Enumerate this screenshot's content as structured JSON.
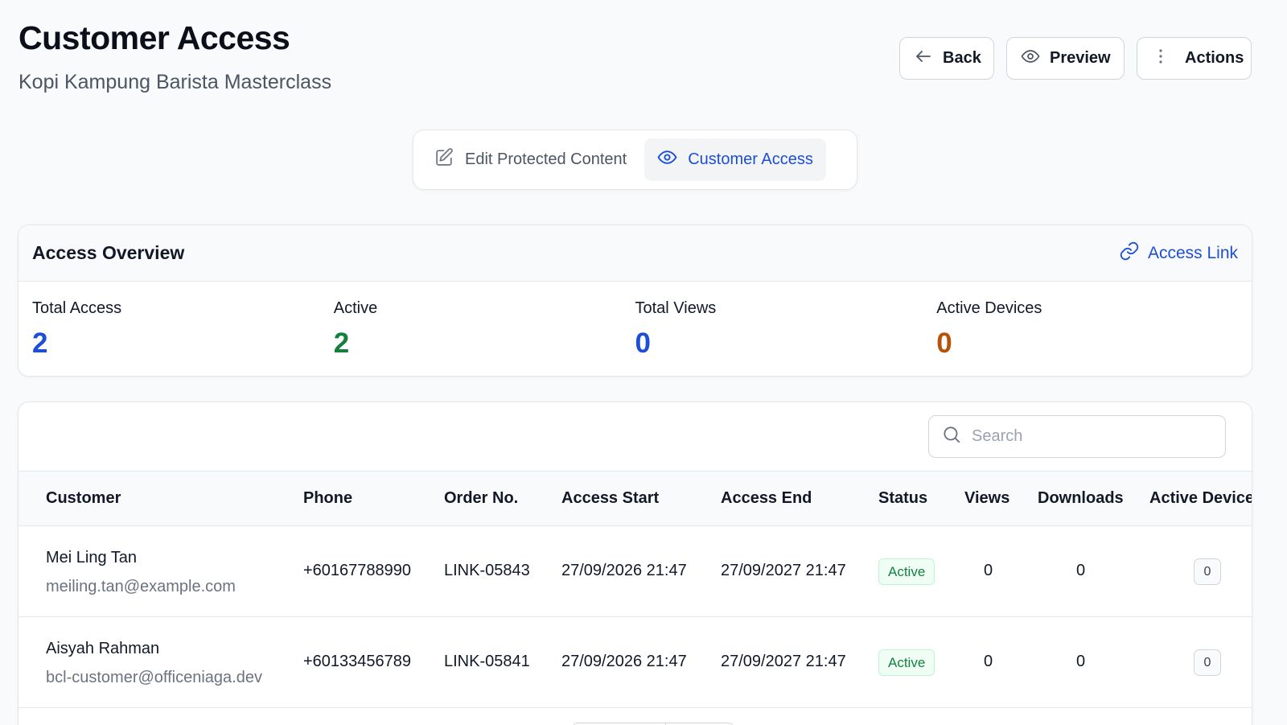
{
  "header": {
    "title": "Customer Access",
    "subtitle": "Kopi Kampung Barista Masterclass",
    "back_label": "Back",
    "preview_label": "Preview",
    "actions_label": "Actions"
  },
  "tabs": [
    {
      "label": "Edit Protected Content",
      "icon": "pencil-square-icon",
      "active": false
    },
    {
      "label": "Customer Access",
      "icon": "eye-icon",
      "active": true
    }
  ],
  "overview": {
    "title": "Access Overview",
    "access_link_label": "Access Link",
    "stats": [
      {
        "label": "Total Access",
        "value": "2",
        "color": "#1d4ed8"
      },
      {
        "label": "Active",
        "value": "2",
        "color": "#15803d"
      },
      {
        "label": "Total Views",
        "value": "0",
        "color": "#1d4ed8"
      },
      {
        "label": "Active Devices",
        "value": "0",
        "color": "#b45309"
      }
    ]
  },
  "search": {
    "placeholder": "Search",
    "value": ""
  },
  "table": {
    "columns": [
      "Customer",
      "Phone",
      "Order No.",
      "Access Start",
      "Access End",
      "Status",
      "Views",
      "Downloads",
      "Active Device"
    ],
    "rows": [
      {
        "name": "Mei Ling Tan",
        "email": "meiling.tan@example.com",
        "phone": "+60167788990",
        "order_no": "LINK-05843",
        "access_start": "27/09/2026 21:47",
        "access_end": "27/09/2027 21:47",
        "status": "Active",
        "views": "0",
        "downloads": "0",
        "active_devices": "0"
      },
      {
        "name": "Aisyah Rahman",
        "email": "bcl-customer@officeniaga.dev",
        "phone": "+60133456789",
        "order_no": "LINK-05841",
        "access_start": "27/09/2026 21:47",
        "access_end": "27/09/2027 21:47",
        "status": "Active",
        "views": "0",
        "downloads": "0",
        "active_devices": "0"
      }
    ]
  },
  "colors": {
    "accent": "#1d4ed8",
    "success": "#15803d",
    "warning": "#b45309",
    "border": "#e5e7eb"
  }
}
